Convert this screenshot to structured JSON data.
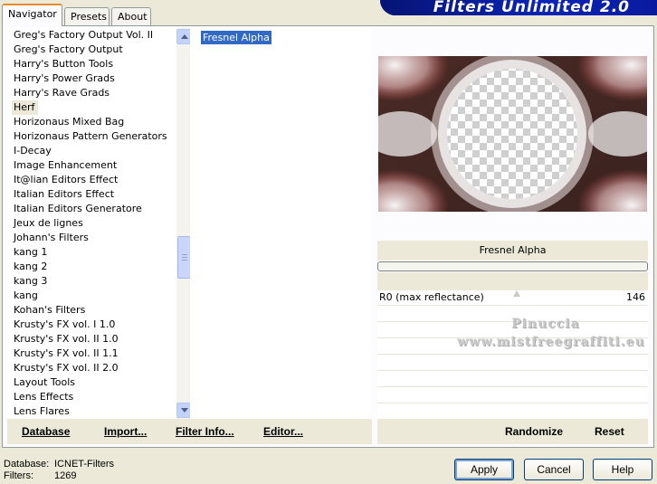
{
  "tabs": [
    "Navigator",
    "Presets",
    "About"
  ],
  "banner_title": "Filters Unlimited 2.0",
  "categories": [
    "Greg's Factory Output Vol. II",
    "Greg's Factory Output",
    "Harry's Button Tools",
    "Harry's Power Grads",
    "Harry's Rave Grads",
    "Herf",
    "Horizonaus Mixed Bag",
    "Horizonaus Pattern Generators",
    "I-Decay",
    "Image Enhancement",
    "It@lian Editors Effect",
    "Italian Editors Effect",
    "Italian Editors Generatore",
    "Jeux de lignes",
    "Johann's Filters",
    "kang 1",
    "kang 2",
    "kang 3",
    "kang",
    "Kohan's Filters",
    "Krusty's FX vol. I 1.0",
    "Krusty's FX vol. II 1.0",
    "Krusty's FX vol. II 1.1",
    "Krusty's FX vol. II 2.0",
    "Layout Tools",
    "Lens Effects",
    "Lens Flares"
  ],
  "selected_category": "Herf",
  "filters": [
    "Fresnel Alpha"
  ],
  "selected_filter": "Fresnel Alpha",
  "filter_title": "Fresnel Alpha",
  "param": {
    "label": "R0 (max reflectance)",
    "value": "146"
  },
  "watermark": {
    "line1": "Pinuccia",
    "line2": "www.mistfreegraffiti.eu"
  },
  "left_buttons": {
    "database": "Database",
    "import": "Import...",
    "filter_info": "Filter Info...",
    "editor": "Editor..."
  },
  "right_buttons": {
    "randomize": "Randomize",
    "reset": "Reset"
  },
  "status": {
    "database_label": "Database:",
    "database_value": "ICNET-Filters",
    "filters_label": "Filters:",
    "filters_value": "1269"
  },
  "dialog_buttons": {
    "apply": "Apply",
    "cancel": "Cancel",
    "help": "Help"
  },
  "colors": {
    "selection": "#316ac5",
    "dialog_bg": "#ece9d8",
    "banner": "#0a1a9e"
  }
}
